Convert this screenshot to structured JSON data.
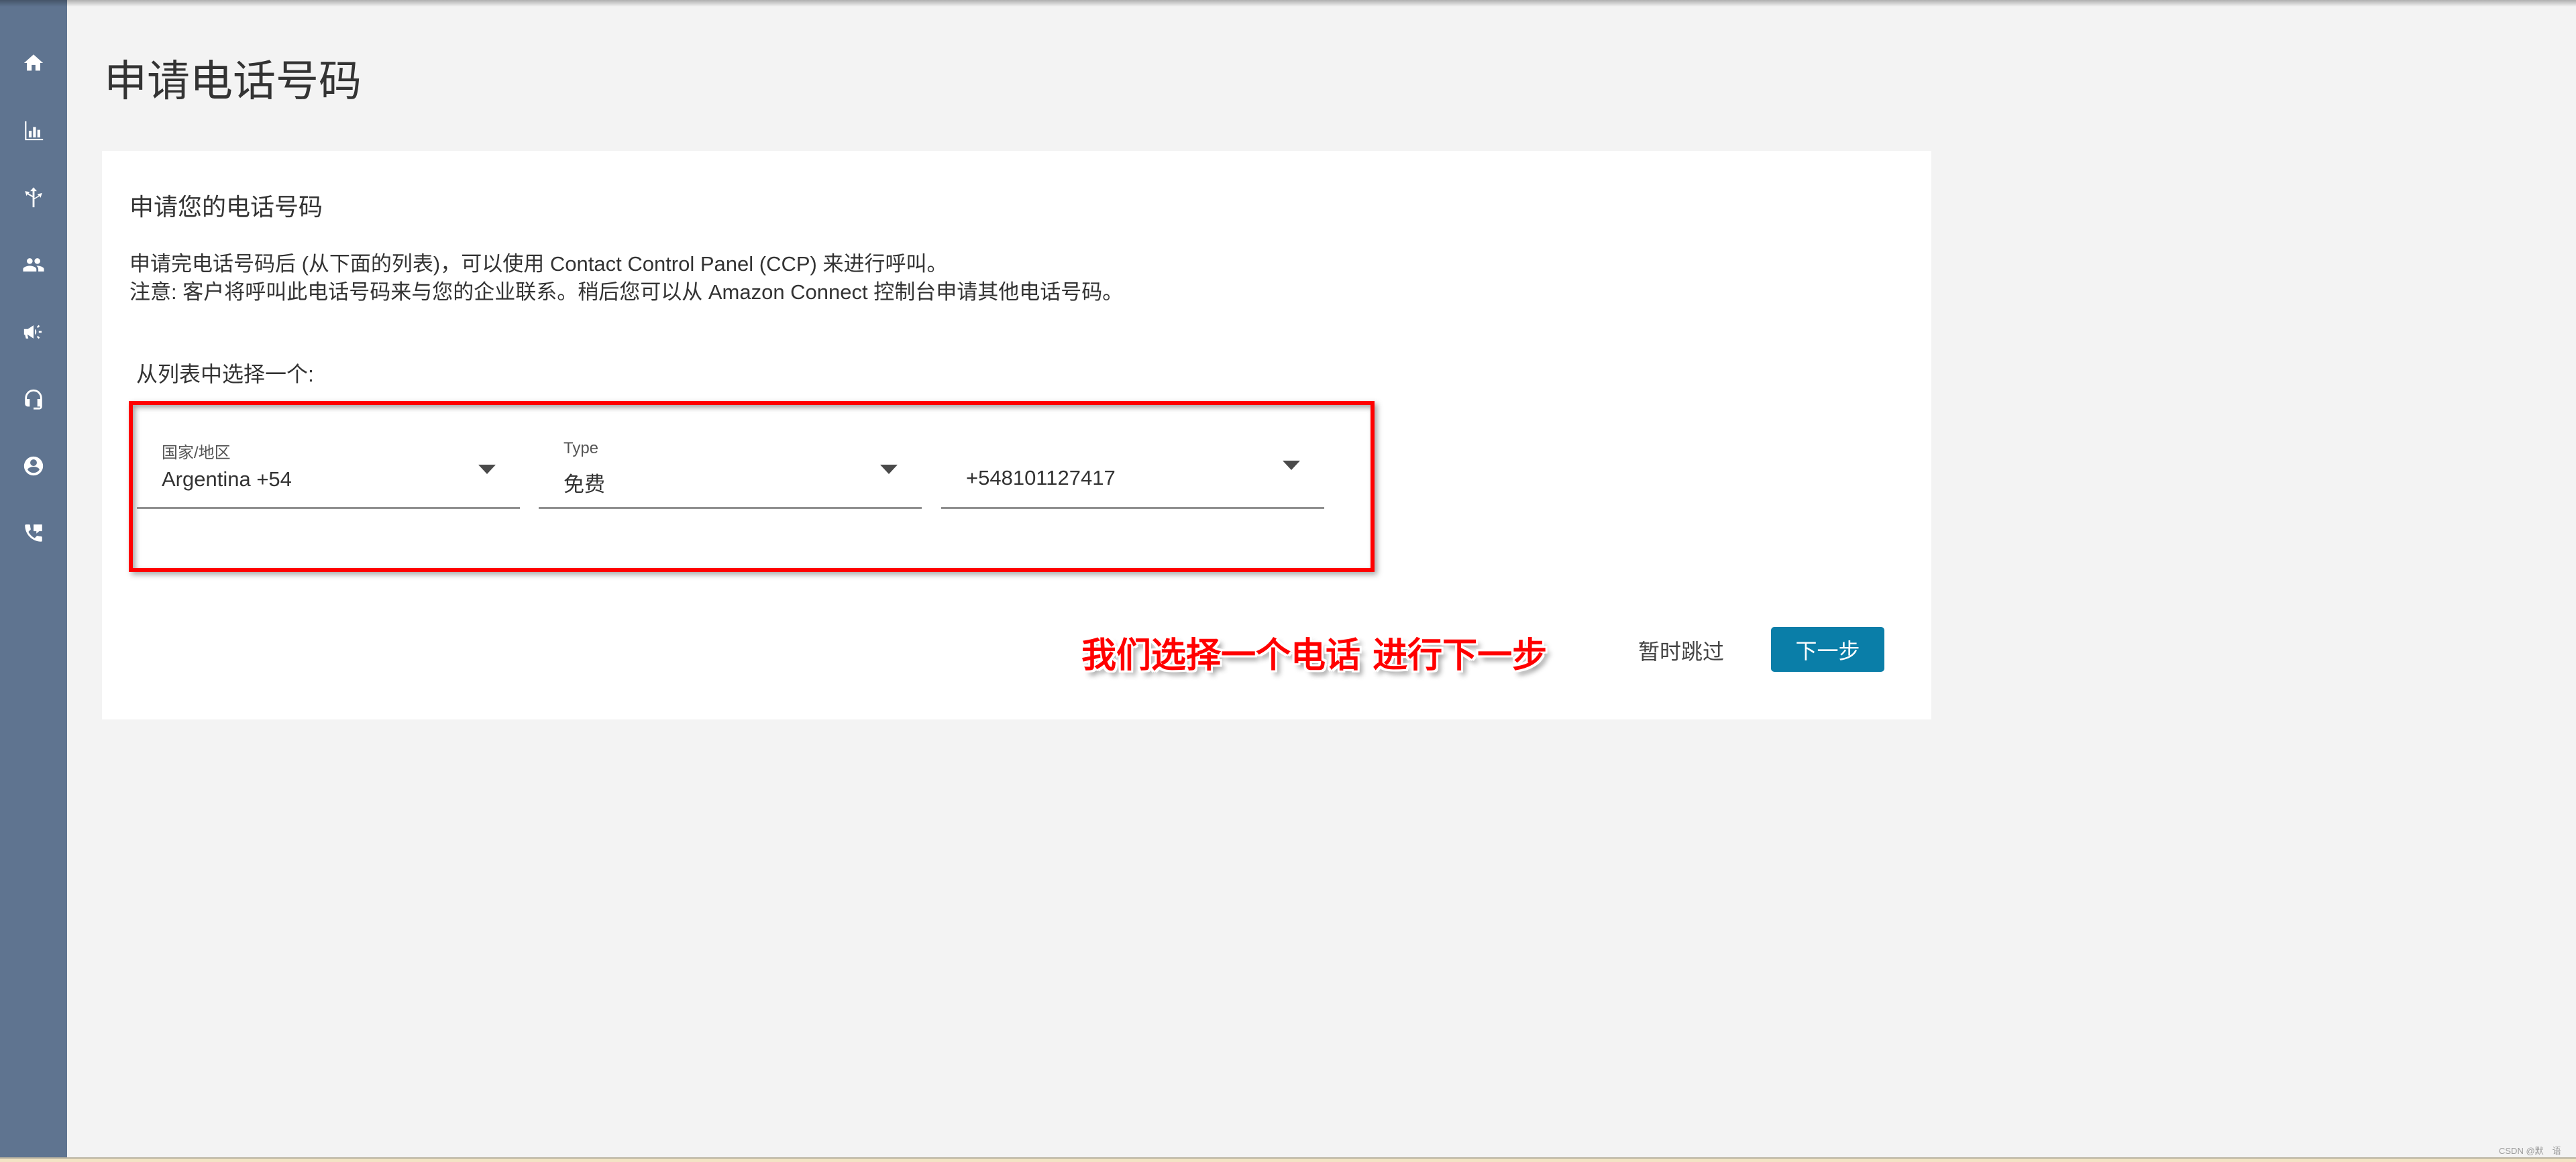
{
  "sidebar": {
    "items": [
      {
        "name": "home",
        "icon": "home-icon"
      },
      {
        "name": "metrics",
        "icon": "bar-chart-icon"
      },
      {
        "name": "routing",
        "icon": "routing-arrows-icon"
      },
      {
        "name": "users",
        "icon": "users-icon"
      },
      {
        "name": "campaigns",
        "icon": "megaphone-icon"
      },
      {
        "name": "channels",
        "icon": "headset-icon"
      },
      {
        "name": "profile",
        "icon": "user-circle-icon"
      },
      {
        "name": "phone-numbers",
        "icon": "phone-forward-icon"
      }
    ]
  },
  "page": {
    "title": "申请电话号码"
  },
  "card": {
    "heading": "申请您的电话号码",
    "description_line1": "申请完电话号码后 (从下面的列表)，可以使用 Contact Control Panel (CCP) 来进行呼叫。",
    "description_line2": "注意: 客户将呼叫此电话号码来与您的企业联系。稍后您可以从 Amazon Connect 控制台申请其他电话号码。",
    "select_prompt": "从列表中选择一个:",
    "fields": {
      "country": {
        "label": "国家/地区",
        "value": "Argentina +54"
      },
      "type": {
        "label": "Type",
        "value": "免费"
      },
      "phone": {
        "label": "",
        "value": "+548101127417"
      }
    },
    "skip_label": "暂时跳过",
    "next_label": "下一步"
  },
  "annotation": {
    "text": "我们选择一个电话 进行下一步",
    "color": "#ff0000"
  },
  "colors": {
    "sidebar": "#5f7490",
    "primary_button": "#0a7ea8",
    "highlight_border": "#ff0000"
  },
  "watermark": "CSDN @默　语"
}
